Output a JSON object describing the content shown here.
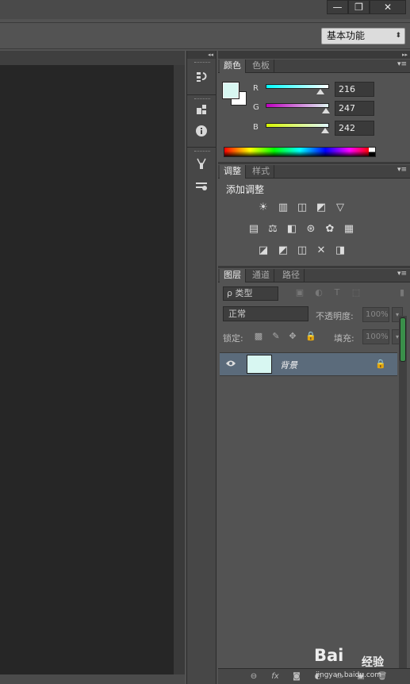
{
  "window": {
    "minimize": "—",
    "restore": "❐",
    "close": "✕"
  },
  "options_bar": {
    "workspace": "基本功能",
    "workspace_arrow": "⬍"
  },
  "dock": {
    "collapse_left": "◂◂",
    "collapse_right": "▸▸"
  },
  "color_panel": {
    "tabs": [
      "颜色",
      "色板"
    ],
    "foreground": "#d8f7f2",
    "background": "#ffffff",
    "channels": [
      {
        "label": "R",
        "value": "216",
        "from": "#00ffff",
        "to": "#ffffff"
      },
      {
        "label": "G",
        "value": "247",
        "from": "#c000c0",
        "to": "#d8f7f2"
      },
      {
        "label": "B",
        "value": "242",
        "from": "#d8f700",
        "to": "#d8f7ff"
      }
    ],
    "menu_icon": "▾≡"
  },
  "adjustments_panel": {
    "tabs": [
      "调整",
      "样式"
    ],
    "title": "添加调整",
    "icons": [
      [
        "☀",
        "▥",
        "◫",
        "◩",
        "▽"
      ],
      [
        "▤",
        "⚖",
        "◧",
        "⊛",
        "✿",
        "▦"
      ],
      [
        "◪",
        "◩",
        "◫",
        "✕",
        "◨"
      ]
    ]
  },
  "layers_panel": {
    "tabs": [
      "图层",
      "通道",
      "路径"
    ],
    "filter_kind": "ρ 类型",
    "filter_icons": [
      "▣",
      "◐",
      "T",
      "⬚",
      "▮"
    ],
    "blend_mode": "正常",
    "opacity_label": "不透明度:",
    "opacity_value": "100%",
    "lock_label": "锁定:",
    "lock_icons": [
      "▩",
      "✎",
      "✥",
      "🔒"
    ],
    "fill_label": "填充:",
    "fill_value": "100%",
    "layers": [
      {
        "name": "背景",
        "visible": true,
        "locked": true,
        "thumbnail_color": "#d8f7f2"
      }
    ],
    "footer_icons": [
      "⊖",
      "fx",
      "◙",
      "◐",
      "▭",
      "▣",
      "🗑"
    ]
  },
  "watermark": {
    "brand": "Bai",
    "brand2": "经验",
    "url": "jingyan.baidu.com"
  }
}
